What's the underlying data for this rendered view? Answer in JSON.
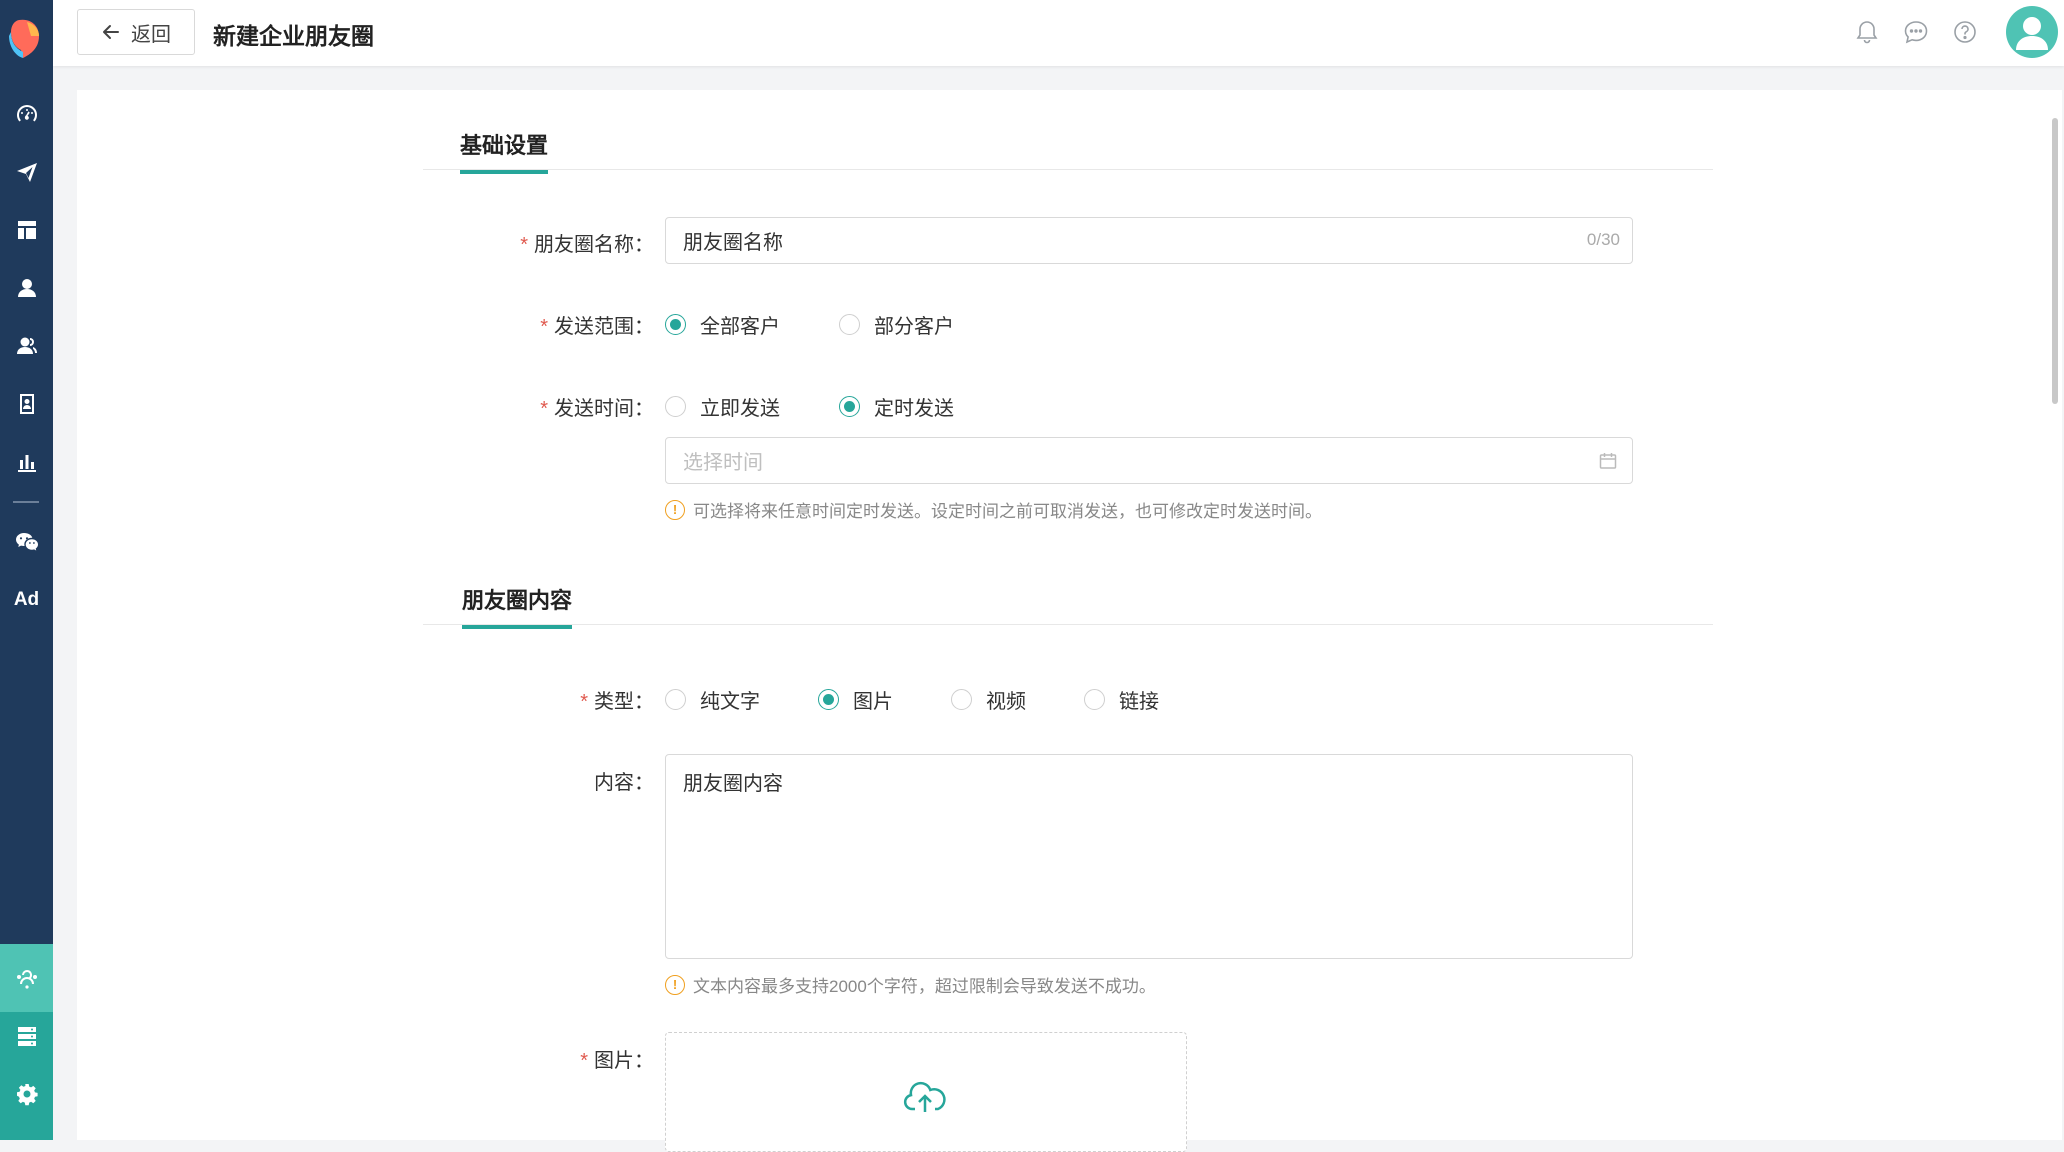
{
  "header": {
    "back_label": "返回",
    "title": "新建企业朋友圈"
  },
  "sidebar": {
    "items": [
      {
        "icon": "dashboard-icon"
      },
      {
        "icon": "send-icon"
      },
      {
        "icon": "layout-icon"
      },
      {
        "icon": "user-icon"
      },
      {
        "icon": "users-icon"
      },
      {
        "icon": "contact-card-icon"
      },
      {
        "icon": "bar-chart-icon"
      },
      {
        "icon": "wechat-icon"
      },
      {
        "icon": "ad-icon",
        "text": "Ad"
      },
      {
        "icon": "moments-icon"
      },
      {
        "icon": "server-icon"
      },
      {
        "icon": "gear-icon"
      }
    ]
  },
  "basic": {
    "section_title": "基础设置",
    "name_label": "朋友圈名称：",
    "name_value": "朋友圈名称",
    "name_counter": "0/30",
    "scope_label": "发送范围：",
    "scope_all": "全部客户",
    "scope_part": "部分客户",
    "time_label": "发送时间：",
    "time_now": "立即发送",
    "time_scheduled": "定时发送",
    "time_placeholder": "选择时间",
    "time_hint": "可选择将来任意时间定时发送。设定时间之前可取消发送，也可修改定时发送时间。"
  },
  "content": {
    "section_title": "朋友圈内容",
    "type_label": "类型：",
    "type_text": "纯文字",
    "type_image": "图片",
    "type_video": "视频",
    "type_link": "链接",
    "body_label": "内容：",
    "body_value": "朋友圈内容",
    "body_hint": "文本内容最多支持2000个字符，超过限制会导致发送不成功。",
    "image_label": "图片："
  },
  "required_mark": "*",
  "colors": {
    "accent": "#26a69a",
    "sidebar": "#1f3a5c",
    "required": "#e05a4f",
    "warning": "#f0a020"
  }
}
